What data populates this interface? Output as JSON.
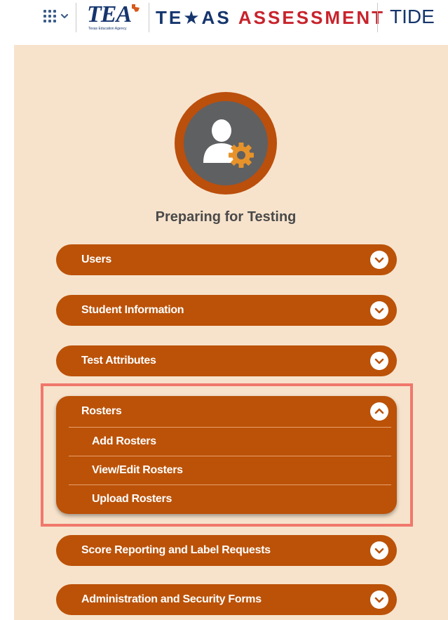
{
  "header": {
    "logo_text": "TEA",
    "logo_subtext": "Texas Education Agency",
    "brand_part1": "TE",
    "brand_star": "★",
    "brand_part2": "AS",
    "brand_part3": "ASSESSMENT",
    "app_name": "TIDE",
    "app_menu_icon": "grid-menu-icon",
    "app_menu_chevron": "chevron-down-icon"
  },
  "panel": {
    "avatar_icon": "user-settings-icon",
    "title": "Preparing for Testing",
    "sections": [
      {
        "label": "Users",
        "expanded": false
      },
      {
        "label": "Student Information",
        "expanded": false
      },
      {
        "label": "Test Attributes",
        "expanded": false
      },
      {
        "label": "Rosters",
        "expanded": true,
        "items": [
          "Add Rosters",
          "View/Edit Rosters",
          "Upload Rosters"
        ]
      },
      {
        "label": "Score Reporting and Label Requests",
        "expanded": false
      },
      {
        "label": "Administration and Security Forms",
        "expanded": false
      }
    ]
  },
  "colors": {
    "panel_bg": "#f7e3cc",
    "accent_orange": "#bb5208",
    "brand_blue": "#15356d",
    "brand_red": "#c8232c",
    "highlight": "#f0786c"
  }
}
